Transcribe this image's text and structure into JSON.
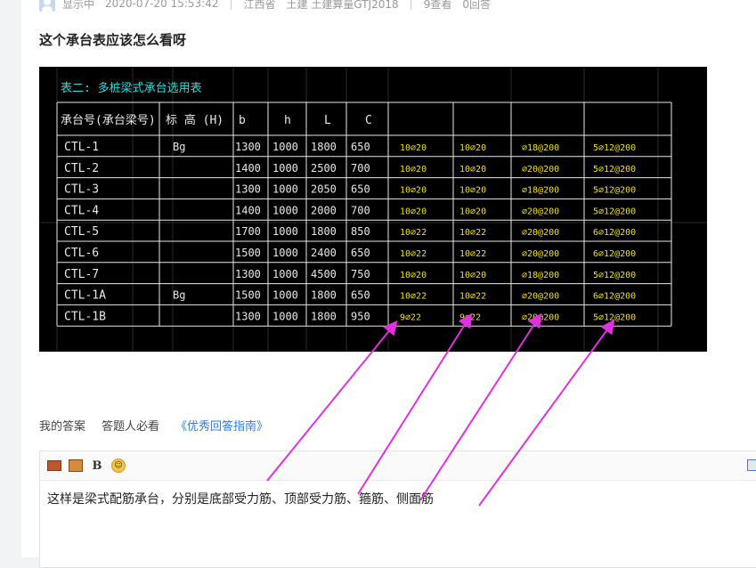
{
  "meta": {
    "status": "显示中",
    "time": "2020-07-20 15:53:42",
    "location": "江西省",
    "category": "土建 土建算量GTJ2018",
    "views": "9查看",
    "answers": "0回答",
    "sep": "|"
  },
  "question": {
    "title": "这个承台表应该怎么看呀"
  },
  "cad": {
    "caption": "表二: 多桩梁式承台选用表",
    "headers": [
      "承台号(承台梁号)",
      "标 高  (H)",
      "b",
      "h",
      "L",
      "C"
    ],
    "rows": [
      [
        "CTL-1",
        "Bg",
        "1300",
        "1000",
        "1800",
        "650",
        "10⌀20",
        "10⌀20",
        "⌀18@200",
        "5⌀12@200"
      ],
      [
        "CTL-2",
        "",
        "1400",
        "1000",
        "2500",
        "700",
        "10⌀20",
        "10⌀20",
        "⌀20@200",
        "5⌀12@200"
      ],
      [
        "CTL-3",
        "",
        "1300",
        "1000",
        "2050",
        "650",
        "10⌀20",
        "10⌀20",
        "⌀18@200",
        "5⌀12@200"
      ],
      [
        "CTL-4",
        "",
        "1400",
        "1000",
        "2000",
        "700",
        "10⌀20",
        "10⌀20",
        "⌀20@200",
        "5⌀12@200"
      ],
      [
        "CTL-5",
        "",
        "1700",
        "1000",
        "1800",
        "850",
        "10⌀22",
        "10⌀22",
        "⌀20@200",
        "6⌀12@200"
      ],
      [
        "CTL-6",
        "",
        "1500",
        "1000",
        "2400",
        "650",
        "10⌀22",
        "10⌀22",
        "⌀20@200",
        "6⌀12@200"
      ],
      [
        "CTL-7",
        "",
        "1300",
        "1000",
        "4500",
        "750",
        "10⌀20",
        "10⌀20",
        "⌀18@200",
        "5⌀12@200"
      ],
      [
        "CTL-1A",
        "Bg",
        "1500",
        "1000",
        "1800",
        "650",
        "10⌀22",
        "10⌀22",
        "⌀20@200",
        "6⌀12@200"
      ],
      [
        "CTL-1B",
        "",
        "1300",
        "1000",
        "1800",
        "950",
        "9⌀22",
        "9⌀22",
        "⌀20@200",
        "5⌀12@200"
      ]
    ]
  },
  "answer_tabs": {
    "my_answer": "我的答案",
    "must_read": "答题人必看",
    "guide_link": "《优秀回答指南》"
  },
  "editor": {
    "bold": "B",
    "text": "这样是梁式配筋承台，分别是底部受力筋、顶部受力筋、箍筋、侧面筋"
  },
  "colors": {
    "cad_white": "#e8e8e8",
    "cad_cyan": "#22e0e0",
    "cad_yellow": "#f0e020",
    "arrow": "#e030e0",
    "link": "#2c7be5"
  }
}
